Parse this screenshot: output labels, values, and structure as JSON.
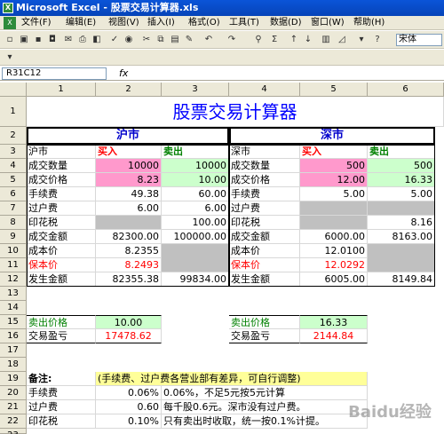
{
  "window": {
    "title": "Microsoft Excel - 股票交易计算器.xls"
  },
  "menu": [
    "文件(F)",
    "编辑(E)",
    "视图(V)",
    "插入(I)",
    "格式(O)",
    "工具(T)",
    "数据(D)",
    "窗口(W)",
    "帮助(H)"
  ],
  "toolbar": {
    "font_name": "宋体"
  },
  "formula_bar": {
    "name_box": "R31C12",
    "fx": "fx"
  },
  "columns": [
    "1",
    "2",
    "3",
    "4",
    "5",
    "6"
  ],
  "rows": [
    "1",
    "2",
    "3",
    "4",
    "5",
    "6",
    "7",
    "8",
    "9",
    "10",
    "11",
    "12",
    "13",
    "14",
    "15",
    "16",
    "17",
    "18",
    "19",
    "20",
    "21",
    "22",
    "23"
  ],
  "sheet": {
    "title": "股票交易计算器",
    "sh": {
      "header": "沪市",
      "market": "沪市",
      "buy": "买入",
      "sell": "卖出",
      "qty_label": "成交数量",
      "qty_buy": "10000",
      "qty_sell": "10000",
      "price_label": "成交价格",
      "price_buy": "8.23",
      "price_sell": "10.00",
      "fee_label": "手续费",
      "fee_buy": "49.38",
      "fee_sell": "60.00",
      "transfer_label": "过户费",
      "transfer_buy": "6.00",
      "transfer_sell": "6.00",
      "stamp_label": "印花税",
      "stamp_sell": "100.00",
      "amount_label": "成交金额",
      "amount_buy": "82300.00",
      "amount_sell": "100000.00",
      "cost_label": "成本价",
      "cost": "8.2355",
      "breakeven_label": "保本价",
      "breakeven": "8.2493",
      "occur_label": "发生金额",
      "occur_buy": "82355.38",
      "occur_sell": "99834.00",
      "sell_price_label": "卖出价格",
      "sell_price": "10.00",
      "profit_label": "交易盈亏",
      "profit": "17478.62"
    },
    "sz": {
      "header": "深市",
      "market": "深市",
      "buy": "买入",
      "sell": "卖出",
      "qty_label": "成交数量",
      "qty_buy": "500",
      "qty_sell": "500",
      "price_label": "成交价格",
      "price_buy": "12.00",
      "price_sell": "16.33",
      "fee_label": "手续费",
      "fee_buy": "5.00",
      "fee_sell": "5.00",
      "transfer_label": "过户费",
      "stamp_label": "印花税",
      "stamp_sell": "8.16",
      "amount_label": "成交金额",
      "amount_buy": "6000.00",
      "amount_sell": "8163.00",
      "cost_label": "成本价",
      "cost": "12.0100",
      "breakeven_label": "保本价",
      "breakeven": "12.0292",
      "occur_label": "发生金额",
      "occur_buy": "6005.00",
      "occur_sell": "8149.84",
      "sell_price_label": "卖出价格",
      "sell_price": "16.33",
      "profit_label": "交易盈亏",
      "profit": "2144.84"
    },
    "notes": {
      "label": "备注:",
      "remark": "(手续费、过户费各营业部有差异，可自行调整)",
      "fee_label": "手续费",
      "fee_rate": "0.06%",
      "fee_text": "0.06%，不足5元按5元计算",
      "transfer_label": "过户费",
      "transfer_rate": "0.60",
      "transfer_text": "每千股0.6元。深市没有过户费。",
      "stamp_label": "印花税",
      "stamp_rate": "0.10%",
      "stamp_text": "只有卖出时收取，统一按0.1%计提。"
    }
  },
  "watermark": "Baidu经验",
  "colors": {
    "buy_fill": "#ff99cc",
    "sell_fill": "#ccffcc",
    "gray_fill": "#c0c0c0",
    "note_fill": "#ffff99",
    "title": "#0000ff"
  }
}
